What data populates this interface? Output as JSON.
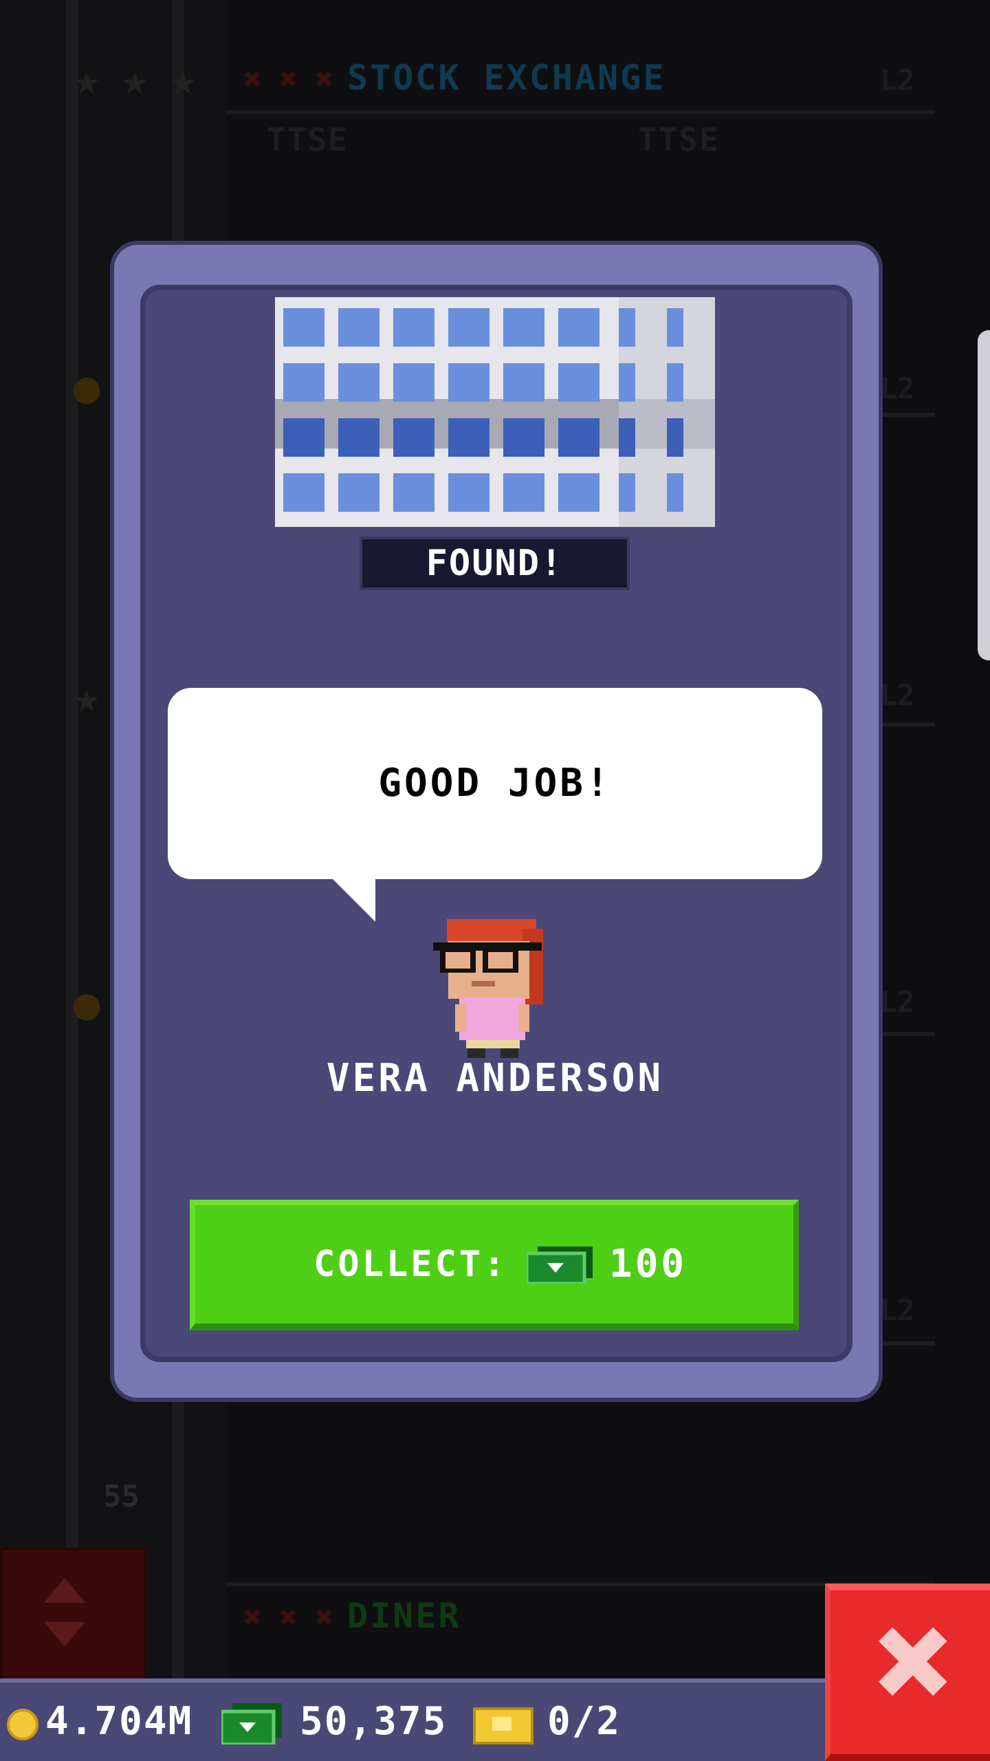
{
  "background": {
    "floors": [
      {
        "name": "STOCK EXCHANGE",
        "level_tag": "L2",
        "color": "#0f3b52"
      },
      {
        "name": "DINER",
        "level_tag": "",
        "color": "#0f3a14"
      }
    ],
    "ttse_sign": "TTSE",
    "floor_number": "55",
    "level_tags": [
      "L2",
      "L2",
      "L2",
      "L2"
    ]
  },
  "modal": {
    "banner": "FOUND!",
    "speech": "GOOD JOB!",
    "character_name": "VERA ANDERSON",
    "collect_label": "COLLECT:",
    "collect_amount": "100",
    "icons": {
      "building": "office-building-icon",
      "character": "vera-anderson-avatar",
      "cash": "cash-icon"
    }
  },
  "bottom_bar": {
    "coins": "4.704M",
    "cash": "50,375",
    "tickets": "0/2"
  },
  "colors": {
    "modal_frame": "#7b77b3",
    "modal_body": "#4b4877",
    "collect_button": "#4fce16",
    "close_button": "#e82a2a",
    "coin": "#f3c93a"
  }
}
